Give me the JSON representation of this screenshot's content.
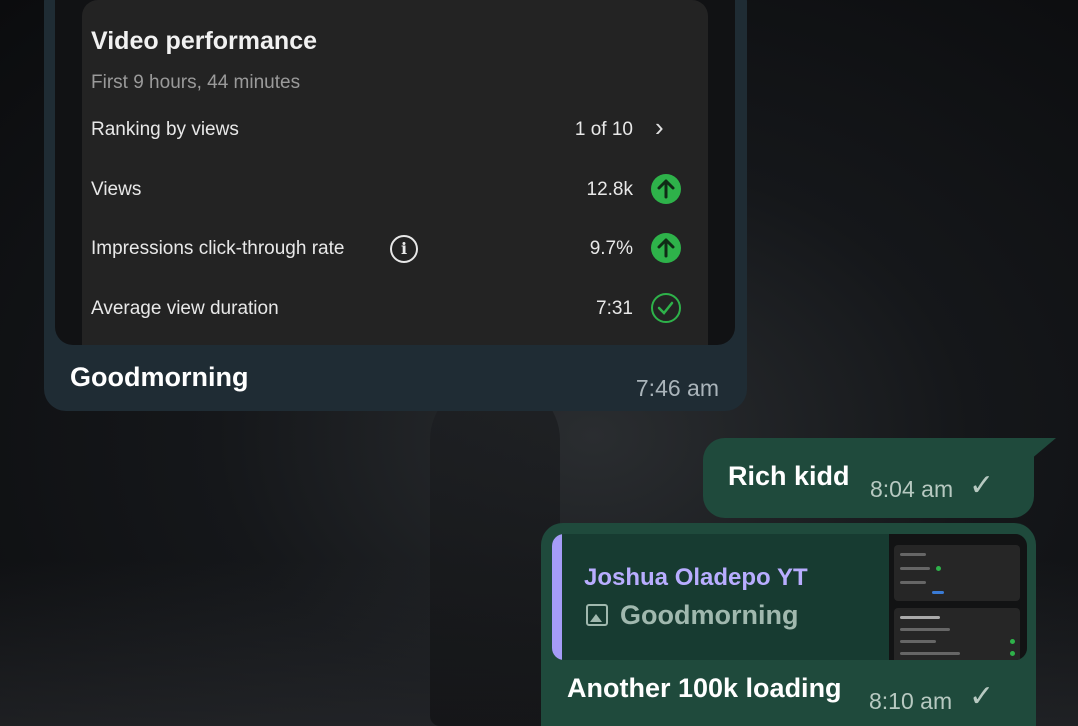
{
  "incoming": {
    "card": {
      "title": "Video performance",
      "subtitle": "First 9 hours, 44 minutes",
      "rows": [
        {
          "label": "Ranking by views",
          "value": "1 of 10",
          "icon": "chevron-right-icon"
        },
        {
          "label": "Views",
          "value": "12.8k",
          "icon": "arrow-up-circle-icon"
        },
        {
          "label": "Impressions click-through rate",
          "value": "9.7%",
          "icon": "arrow-up-circle-icon"
        },
        {
          "label": "Average view duration",
          "value": "7:31",
          "icon": "check-circle-icon"
        }
      ]
    },
    "caption": "Goodmorning",
    "time": "7:46 am"
  },
  "outgoing": [
    {
      "text": "Rich kidd",
      "time": "8:04 am",
      "status": "sent"
    },
    {
      "reply_to": {
        "author": "Joshua Oladepo YT",
        "text": "Goodmorning"
      },
      "text": "Another 100k loading",
      "time": "8:10 am",
      "status": "sent"
    }
  ],
  "colors": {
    "incoming_bubble": "#1f2c34",
    "outgoing_bubble": "#1f4a3c",
    "positive_green": "#2eb24a",
    "quote_author": "#b8adff"
  }
}
